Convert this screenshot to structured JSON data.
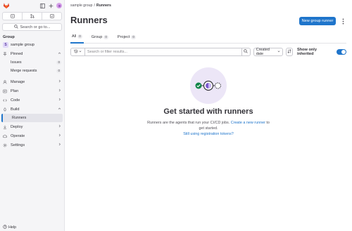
{
  "sidebar": {
    "context_label": "Group",
    "group": {
      "initial": "S",
      "name": "sample group"
    },
    "search_label": "Search or go to...",
    "pinned": {
      "label": "Pinned",
      "items": [
        {
          "label": "Issues",
          "count": "0"
        },
        {
          "label": "Merge requests",
          "count": "0"
        }
      ]
    },
    "nav": {
      "manage": "Manage",
      "plan": "Plan",
      "code": "Code",
      "build": "Build",
      "runners": "Runners",
      "deploy": "Deploy",
      "operate": "Operate",
      "settings": "Settings"
    },
    "help_label": "Help"
  },
  "breadcrumb": {
    "group": "sample group",
    "separator": "/",
    "current": "Runners"
  },
  "page": {
    "title": "Runners",
    "new_button": "New group runner"
  },
  "tabs": [
    {
      "label": "All",
      "count": "0"
    },
    {
      "label": "Group",
      "count": "0"
    },
    {
      "label": "Project",
      "count": "0"
    }
  ],
  "filter": {
    "placeholder": "Search or filter results...",
    "sort_label": "Created date",
    "toggle_label": "Show only inherited",
    "toggle_on": true
  },
  "empty_state": {
    "title": "Get started with runners",
    "desc_before": "Runners are the agents that run your CI/CD jobs.",
    "desc_link": "Create a new runner",
    "desc_after": "to get started.",
    "tokens_link": "Still using registration tokens?"
  },
  "colors": {
    "accent": "#1f75cb",
    "illustration_bg": "#ece6f7",
    "success": "#108548",
    "brand_logo": "#e24329"
  },
  "icons": [
    "gitlab-logo",
    "sidebar-toggle-icon",
    "plus-icon",
    "issues-icon",
    "merge-request-icon",
    "todo-icon",
    "search-icon",
    "pin-icon",
    "manage-icon",
    "plan-icon",
    "code-icon",
    "rocket-icon",
    "deploy-icon",
    "cloud-icon",
    "gear-icon",
    "help-icon",
    "history-icon",
    "sort-icon",
    "kebab-icon"
  ]
}
